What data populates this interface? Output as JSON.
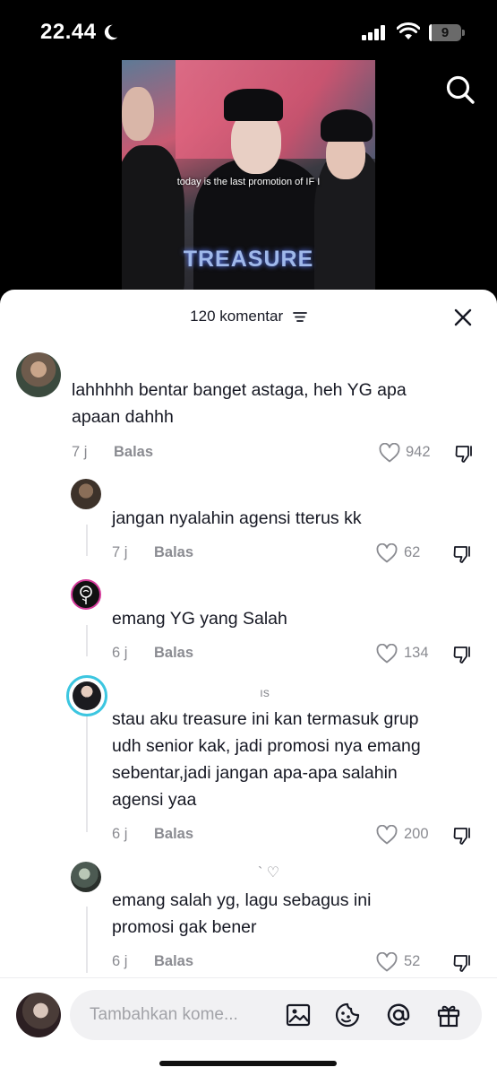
{
  "status_bar": {
    "time": "22.44",
    "battery": "9",
    "battery_level": 0.09
  },
  "video": {
    "caption": "today is the last promotion of IF I",
    "brand": "TREASURE"
  },
  "icons": {
    "search": "search-icon",
    "filter": "filter-icon",
    "close": "close-icon",
    "heart": "heart-outline-icon",
    "dislike": "thumbs-down-icon",
    "image": "image-icon",
    "emoji": "emoji-icon",
    "mention": "at-mention-icon",
    "gift": "gift-icon"
  },
  "colors": {
    "text": "#161823",
    "muted": "#8a8b91",
    "sheet_bg": "#ffffff",
    "input_bg": "#f1f1f3"
  },
  "sheet": {
    "title": "120 komentar"
  },
  "comments": [
    {
      "text_lines": [
        "lahhhhh bentar banget astaga, heh YG apa",
        "apaan dahhh"
      ],
      "time": "7 j",
      "reply_label": "Balas",
      "likes": "942"
    },
    {
      "text_lines": [
        "jangan nyalahin agensi tterus kk"
      ],
      "time": "7 j",
      "reply_label": "Balas",
      "likes": "62"
    },
    {
      "text_lines": [
        "emang YG yang Salah"
      ],
      "time": "6 j",
      "reply_label": "Balas",
      "likes": "134"
    },
    {
      "username": "ıs",
      "text_lines": [
        "stau aku treasure ini kan termasuk grup",
        "udh senior kak, jadi promosi nya emang",
        "sebentar,jadi jangan apa-apa salahin",
        "agensi yaa"
      ],
      "time": "6 j",
      "reply_label": "Balas",
      "likes": "200"
    },
    {
      "username": "` ♡",
      "text_lines": [
        "emang salah yg, lagu sebagus ini",
        "promosi gak bener"
      ],
      "time": "6 j",
      "reply_label": "Balas",
      "likes": "52"
    }
  ],
  "composer": {
    "placeholder": "Tambahkan kome..."
  }
}
